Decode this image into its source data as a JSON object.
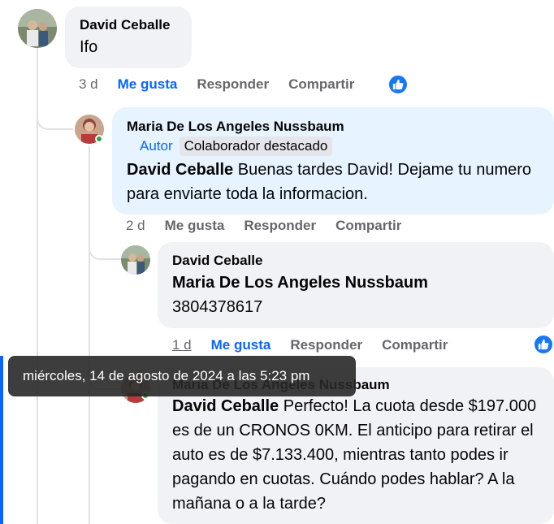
{
  "comments": [
    {
      "author": "David Ceballe",
      "text": "Ifo",
      "time": "3 d",
      "like_label": "Me gusta",
      "reply_label": "Responder",
      "share_label": "Compartir"
    },
    {
      "author": "Maria De Los Angeles Nussbaum",
      "badge_author": "Autor",
      "badge_collab": "Colaborador destacado",
      "mention": "David Ceballe",
      "text": " Buenas tardes David! Dejame tu numero para enviarte toda la informacion.",
      "time": "2 d",
      "like_label": "Me gusta",
      "reply_label": "Responder",
      "share_label": "Compartir"
    },
    {
      "author": "David Ceballe",
      "mention": "Maria De Los Angeles Nussbaum",
      "text": "3804378617",
      "time": "1 d",
      "like_label": "Me gusta",
      "reply_label": "Responder",
      "share_label": "Compartir"
    },
    {
      "author": "Maria De Los Angeles Nussbaum",
      "mention": "David Ceballe",
      "text": " Perfecto! La cuota desde $197.000 es de un CRONOS 0KM. El anticipo para retirar el auto es de $7.133.400, mientras tanto podes ir pagando en cuotas. Cuándo podes hablar? A la mañana o a la tarde?"
    }
  ],
  "tooltip": "miércoles, 14 de agosto de 2024 a las 5:23 pm",
  "colors": {
    "link_blue": "#0866ff",
    "bubble": "#f0f2f5",
    "bubble_highlight": "#e7f3ff",
    "online": "#31a24c"
  }
}
